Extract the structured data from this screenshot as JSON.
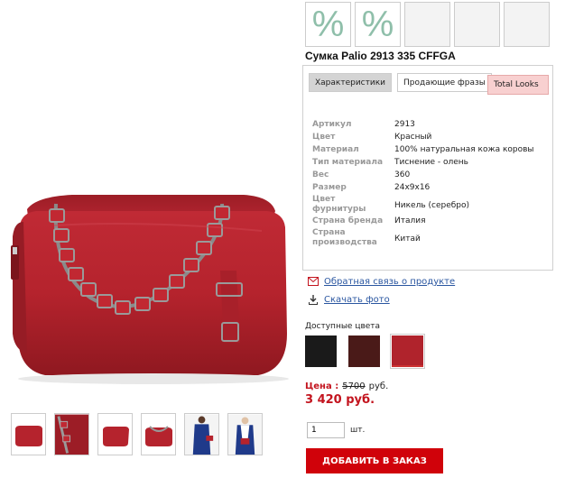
{
  "product": {
    "title": "Сумка Palio 2913 335 CFFGA"
  },
  "badges": [
    {
      "label": "%"
    },
    {
      "label": "%"
    },
    {
      "label": ""
    },
    {
      "label": ""
    },
    {
      "label": ""
    }
  ],
  "tabs": [
    {
      "label": "Характеристики",
      "active": true
    },
    {
      "label": "Продающие фразы",
      "active": false
    },
    {
      "label": "Total Looks",
      "active": false
    }
  ],
  "specs": [
    {
      "key": "Артикул",
      "value": "2913"
    },
    {
      "key": "Цвет",
      "value": "Красный"
    },
    {
      "key": "Материал",
      "value": "100% натуральная кожа коровы"
    },
    {
      "key": "Тип материала",
      "value": "Тиснение - олень"
    },
    {
      "key": "Вес",
      "value": "360"
    },
    {
      "key": "Размер",
      "value": "24x9x16"
    },
    {
      "key_line1": "Цвет",
      "key_line2": "фурнитуры",
      "value": "Никель (серебро)"
    },
    {
      "key": "Страна бренда",
      "value": "Италия"
    },
    {
      "key_line1": "Страна",
      "key_line2": "производства",
      "value": "Китай"
    }
  ],
  "links": {
    "feedback": "Обратная связь о продукте",
    "download_photo": "Скачать фото"
  },
  "colors": {
    "label": "Доступные цвета",
    "swatches": [
      {
        "name": "black",
        "color": "#1a1a1a"
      },
      {
        "name": "burgundy",
        "color": "#4a1a18"
      },
      {
        "name": "red",
        "color": "#b0232c",
        "selected": true
      }
    ]
  },
  "price": {
    "label": "Цена :",
    "old": "5700",
    "currency": "руб.",
    "new": "3 420 руб."
  },
  "quantity": {
    "value": "1",
    "unit": "шт."
  },
  "add_button": "ДОБАВИТЬ В ЗАКАЗ",
  "thumbnails": [
    {
      "name": "bag-front"
    },
    {
      "name": "bag-chain-detail"
    },
    {
      "name": "bag-angle"
    },
    {
      "name": "bag-chain-close"
    },
    {
      "name": "model-blue"
    },
    {
      "name": "model-white"
    }
  ],
  "theme": {
    "accent_red": "#d0020a",
    "price_red": "#c3141e",
    "link_blue": "#2a56a0",
    "badge_green": "#8fbfaa",
    "total_looks_bg": "#f8d0d0"
  }
}
